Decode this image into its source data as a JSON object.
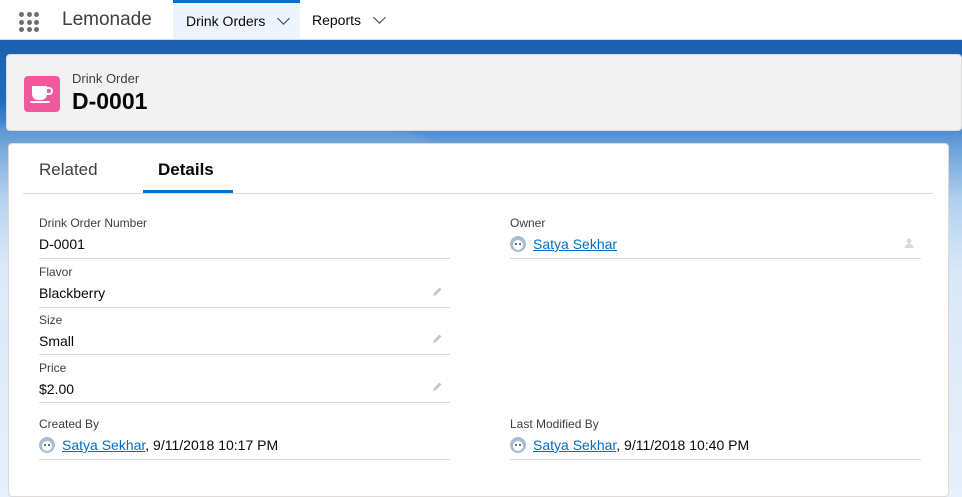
{
  "app": {
    "name": "Lemonade"
  },
  "nav": {
    "tabs": [
      {
        "label": "Drink Orders",
        "active": true
      },
      {
        "label": "Reports",
        "active": false
      }
    ]
  },
  "header": {
    "object_type": "Drink Order",
    "record_name": "D-0001",
    "icon": "cup-icon",
    "icon_color": "#f2599c"
  },
  "detail_tabs": [
    {
      "label": "Related",
      "active": false
    },
    {
      "label": "Details",
      "active": true
    }
  ],
  "fields": {
    "order_number": {
      "label": "Drink Order Number",
      "value": "D-0001"
    },
    "owner": {
      "label": "Owner",
      "value": "Satya Sekhar"
    },
    "flavor": {
      "label": "Flavor",
      "value": "Blackberry"
    },
    "size": {
      "label": "Size",
      "value": "Small"
    },
    "price": {
      "label": "Price",
      "value": "$2.00"
    },
    "created_by": {
      "label": "Created By",
      "user": "Satya Sekhar",
      "date": ", 9/11/2018 10:17 PM"
    },
    "last_modified_by": {
      "label": "Last Modified By",
      "user": "Satya Sekhar",
      "date": ", 9/11/2018 10:40 PM"
    }
  },
  "colors": {
    "brand_blue": "#0070d2",
    "link": "#006dcc"
  }
}
